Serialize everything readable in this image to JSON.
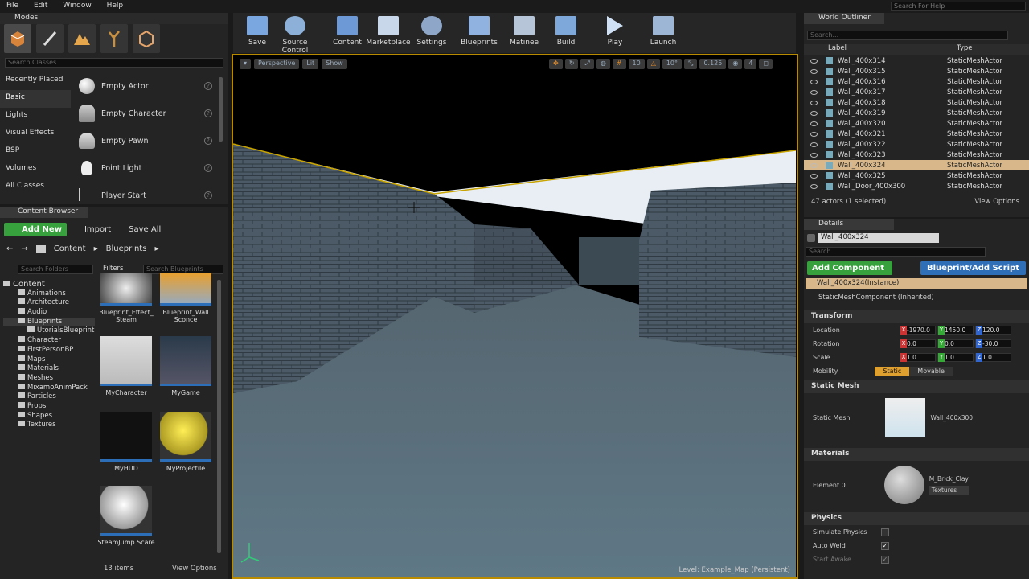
{
  "menu": [
    "File",
    "Edit",
    "Window",
    "Help"
  ],
  "search_help_placeholder": "Search For Help",
  "modes": {
    "tab": "Modes",
    "search_placeholder": "Search Classes",
    "categories": [
      "Recently Placed",
      "Basic",
      "Lights",
      "Visual Effects",
      "BSP",
      "Volumes",
      "All Classes"
    ],
    "items": [
      "Empty Actor",
      "Empty Character",
      "Empty Pawn",
      "Point Light",
      "Player Start"
    ]
  },
  "toolbar": {
    "buttons": [
      "Save",
      "Source Control",
      "Content",
      "Marketplace",
      "Settings",
      "Blueprints",
      "Matinee",
      "Build",
      "Play",
      "Launch"
    ]
  },
  "viewport": {
    "perspective": "Perspective",
    "lit": "Lit",
    "show": "Show",
    "snap_grid": "10",
    "snap_rot": "10°",
    "snap_scale": "0.125",
    "cam_speed": "4",
    "level_label": "Level:",
    "level_name": "Example_Map (Persistent)"
  },
  "outliner": {
    "tab": "World Outliner",
    "search_placeholder": "Search...",
    "col_label": "Label",
    "col_type": "Type",
    "rows": [
      {
        "label": "Wall_400x314",
        "type": "StaticMeshActor"
      },
      {
        "label": "Wall_400x315",
        "type": "StaticMeshActor"
      },
      {
        "label": "Wall_400x316",
        "type": "StaticMeshActor"
      },
      {
        "label": "Wall_400x317",
        "type": "StaticMeshActor"
      },
      {
        "label": "Wall_400x318",
        "type": "StaticMeshActor"
      },
      {
        "label": "Wall_400x319",
        "type": "StaticMeshActor"
      },
      {
        "label": "Wall_400x320",
        "type": "StaticMeshActor"
      },
      {
        "label": "Wall_400x321",
        "type": "StaticMeshActor"
      },
      {
        "label": "Wall_400x322",
        "type": "StaticMeshActor"
      },
      {
        "label": "Wall_400x323",
        "type": "StaticMeshActor"
      },
      {
        "label": "Wall_400x324",
        "type": "StaticMeshActor"
      },
      {
        "label": "Wall_400x325",
        "type": "StaticMeshActor"
      },
      {
        "label": "Wall_Door_400x300",
        "type": "StaticMeshActor"
      }
    ],
    "selected_row": 10,
    "count": "47 actors (1 selected)",
    "view_options": "View Options"
  },
  "details": {
    "tab": "Details",
    "name_value": "Wall_400x324",
    "search_placeholder": "Search",
    "add_component": "Add Component",
    "blueprint_script": "Blueprint/Add Script",
    "instance": "Wall_400x324(Instance)",
    "component": "StaticMeshComponent (Inherited)",
    "transform": {
      "title": "Transform",
      "location_label": "Location",
      "location": [
        "-1970.0",
        "1450.0",
        "120.0"
      ],
      "rotation_label": "Rotation",
      "rotation": [
        "0.0",
        "0.0",
        "-30.0"
      ],
      "scale_label": "Scale",
      "scale": [
        "1.0",
        "1.0",
        "1.0"
      ],
      "mobility_label": "Mobility",
      "static": "Static",
      "movable": "Movable"
    },
    "static_mesh": {
      "title": "Static Mesh",
      "label": "Static Mesh",
      "value": "Wall_400x300"
    },
    "materials": {
      "title": "Materials",
      "label": "Element 0",
      "value": "M_Brick_Clay",
      "textures": "Textures"
    },
    "physics": {
      "title": "Physics",
      "simulate": "Simulate Physics",
      "auto_weld": "Auto Weld",
      "start_awake": "Start Awake"
    }
  },
  "content_browser": {
    "tab": "Content Browser",
    "add_new": "Add New",
    "import": "Import",
    "save_all": "Save All",
    "path": [
      "Content",
      "Blueprints"
    ],
    "folder_search": "Search Folders",
    "filters": "Filters",
    "asset_search": "Search Blueprints",
    "tree": [
      "Content",
      "Animations",
      "Architecture",
      "Audio",
      "Blueprints",
      "UtorialsBlueprint",
      "Character",
      "FirstPersonBP",
      "Maps",
      "Materials",
      "Meshes",
      "MixamoAnimPack",
      "Particles",
      "Props",
      "Shapes",
      "Textures"
    ],
    "assets": [
      "Blueprint_Effect_ Steam",
      "Blueprint_Wall Sconce",
      "MyCharacter",
      "MyGame",
      "MyHUD",
      "MyProjectile",
      "SteamJump Scare"
    ],
    "item_count": "13 items",
    "view_options": "View Options"
  },
  "colors": {
    "accent": "#d8b88a",
    "green": "#37a13d",
    "blue": "#2f6fb8",
    "selection": "#b88b00"
  }
}
